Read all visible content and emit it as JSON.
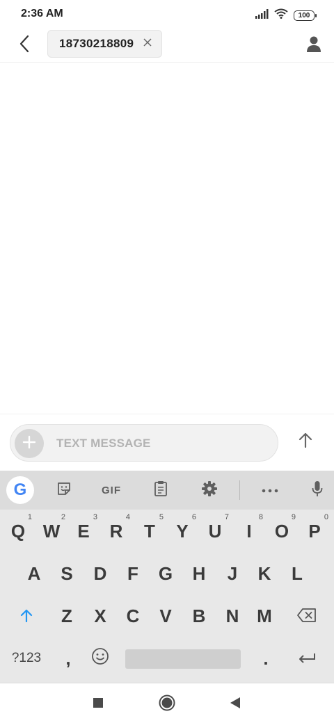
{
  "status_bar": {
    "time": "2:36 AM",
    "battery_level": "100",
    "icons": [
      "signal-icon",
      "wifi-icon",
      "battery-icon"
    ]
  },
  "header": {
    "back_icon": "back-arrow-icon",
    "recipient": "18730218809",
    "remove_icon": "close-icon",
    "contact_icon": "person-icon"
  },
  "compose": {
    "placeholder": "TEXT MESSAGE",
    "add_icon": "plus-icon",
    "send_icon": "send-arrow-icon"
  },
  "keyboard": {
    "toolbar": {
      "google": "G",
      "sticker_icon": "sticker-icon",
      "gif": "GIF",
      "clipboard_icon": "clipboard-icon",
      "settings_icon": "gear-icon",
      "more_icon": "more-icon",
      "mic_icon": "mic-icon"
    },
    "row1": [
      {
        "key": "Q",
        "hint": "1"
      },
      {
        "key": "W",
        "hint": "2"
      },
      {
        "key": "E",
        "hint": "3"
      },
      {
        "key": "R",
        "hint": "4"
      },
      {
        "key": "T",
        "hint": "5"
      },
      {
        "key": "Y",
        "hint": "6"
      },
      {
        "key": "U",
        "hint": "7"
      },
      {
        "key": "I",
        "hint": "8"
      },
      {
        "key": "O",
        "hint": "9"
      },
      {
        "key": "P",
        "hint": "0"
      }
    ],
    "row2": [
      "A",
      "S",
      "D",
      "F",
      "G",
      "H",
      "J",
      "K",
      "L"
    ],
    "row3": [
      "Z",
      "X",
      "C",
      "V",
      "B",
      "N",
      "M"
    ],
    "row4": {
      "symbols": "?123",
      "comma": ",",
      "period": ".",
      "emoji_icon": "emoji-icon",
      "enter_icon": "enter-icon"
    }
  },
  "nav": {
    "icons": [
      "recents-icon",
      "home-icon",
      "back-icon"
    ]
  },
  "colors": {
    "accent_blue": "#2196F3",
    "keyboard_bg": "#e8e8e8",
    "key_text": "#3b3b3b"
  }
}
